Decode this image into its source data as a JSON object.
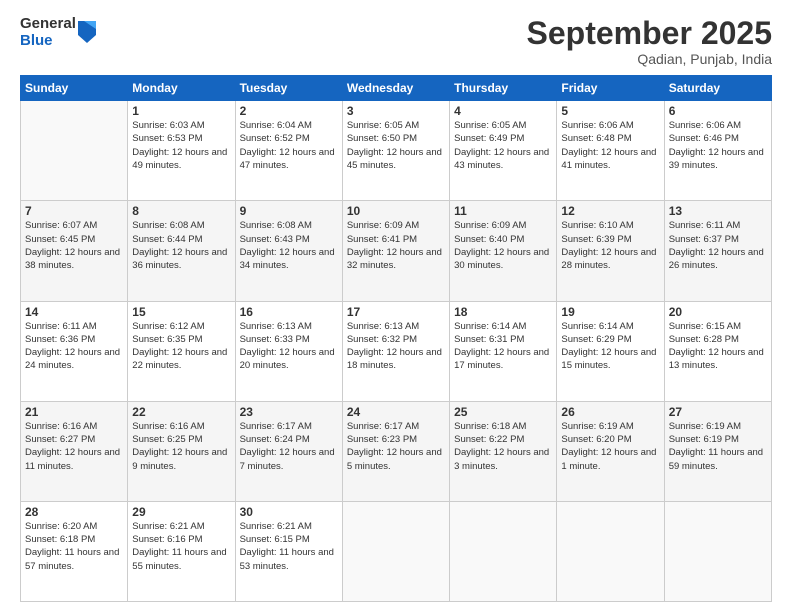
{
  "logo": {
    "general": "General",
    "blue": "Blue"
  },
  "title": "September 2025",
  "subtitle": "Qadian, Punjab, India",
  "weekdays": [
    "Sunday",
    "Monday",
    "Tuesday",
    "Wednesday",
    "Thursday",
    "Friday",
    "Saturday"
  ],
  "weeks": [
    [
      {
        "day": "",
        "sunrise": "",
        "sunset": "",
        "daylight": "",
        "empty": true
      },
      {
        "day": "1",
        "sunrise": "Sunrise: 6:03 AM",
        "sunset": "Sunset: 6:53 PM",
        "daylight": "Daylight: 12 hours and 49 minutes."
      },
      {
        "day": "2",
        "sunrise": "Sunrise: 6:04 AM",
        "sunset": "Sunset: 6:52 PM",
        "daylight": "Daylight: 12 hours and 47 minutes."
      },
      {
        "day": "3",
        "sunrise": "Sunrise: 6:05 AM",
        "sunset": "Sunset: 6:50 PM",
        "daylight": "Daylight: 12 hours and 45 minutes."
      },
      {
        "day": "4",
        "sunrise": "Sunrise: 6:05 AM",
        "sunset": "Sunset: 6:49 PM",
        "daylight": "Daylight: 12 hours and 43 minutes."
      },
      {
        "day": "5",
        "sunrise": "Sunrise: 6:06 AM",
        "sunset": "Sunset: 6:48 PM",
        "daylight": "Daylight: 12 hours and 41 minutes."
      },
      {
        "day": "6",
        "sunrise": "Sunrise: 6:06 AM",
        "sunset": "Sunset: 6:46 PM",
        "daylight": "Daylight: 12 hours and 39 minutes."
      }
    ],
    [
      {
        "day": "7",
        "sunrise": "Sunrise: 6:07 AM",
        "sunset": "Sunset: 6:45 PM",
        "daylight": "Daylight: 12 hours and 38 minutes."
      },
      {
        "day": "8",
        "sunrise": "Sunrise: 6:08 AM",
        "sunset": "Sunset: 6:44 PM",
        "daylight": "Daylight: 12 hours and 36 minutes."
      },
      {
        "day": "9",
        "sunrise": "Sunrise: 6:08 AM",
        "sunset": "Sunset: 6:43 PM",
        "daylight": "Daylight: 12 hours and 34 minutes."
      },
      {
        "day": "10",
        "sunrise": "Sunrise: 6:09 AM",
        "sunset": "Sunset: 6:41 PM",
        "daylight": "Daylight: 12 hours and 32 minutes."
      },
      {
        "day": "11",
        "sunrise": "Sunrise: 6:09 AM",
        "sunset": "Sunset: 6:40 PM",
        "daylight": "Daylight: 12 hours and 30 minutes."
      },
      {
        "day": "12",
        "sunrise": "Sunrise: 6:10 AM",
        "sunset": "Sunset: 6:39 PM",
        "daylight": "Daylight: 12 hours and 28 minutes."
      },
      {
        "day": "13",
        "sunrise": "Sunrise: 6:11 AM",
        "sunset": "Sunset: 6:37 PM",
        "daylight": "Daylight: 12 hours and 26 minutes."
      }
    ],
    [
      {
        "day": "14",
        "sunrise": "Sunrise: 6:11 AM",
        "sunset": "Sunset: 6:36 PM",
        "daylight": "Daylight: 12 hours and 24 minutes."
      },
      {
        "day": "15",
        "sunrise": "Sunrise: 6:12 AM",
        "sunset": "Sunset: 6:35 PM",
        "daylight": "Daylight: 12 hours and 22 minutes."
      },
      {
        "day": "16",
        "sunrise": "Sunrise: 6:13 AM",
        "sunset": "Sunset: 6:33 PM",
        "daylight": "Daylight: 12 hours and 20 minutes."
      },
      {
        "day": "17",
        "sunrise": "Sunrise: 6:13 AM",
        "sunset": "Sunset: 6:32 PM",
        "daylight": "Daylight: 12 hours and 18 minutes."
      },
      {
        "day": "18",
        "sunrise": "Sunrise: 6:14 AM",
        "sunset": "Sunset: 6:31 PM",
        "daylight": "Daylight: 12 hours and 17 minutes."
      },
      {
        "day": "19",
        "sunrise": "Sunrise: 6:14 AM",
        "sunset": "Sunset: 6:29 PM",
        "daylight": "Daylight: 12 hours and 15 minutes."
      },
      {
        "day": "20",
        "sunrise": "Sunrise: 6:15 AM",
        "sunset": "Sunset: 6:28 PM",
        "daylight": "Daylight: 12 hours and 13 minutes."
      }
    ],
    [
      {
        "day": "21",
        "sunrise": "Sunrise: 6:16 AM",
        "sunset": "Sunset: 6:27 PM",
        "daylight": "Daylight: 12 hours and 11 minutes."
      },
      {
        "day": "22",
        "sunrise": "Sunrise: 6:16 AM",
        "sunset": "Sunset: 6:25 PM",
        "daylight": "Daylight: 12 hours and 9 minutes."
      },
      {
        "day": "23",
        "sunrise": "Sunrise: 6:17 AM",
        "sunset": "Sunset: 6:24 PM",
        "daylight": "Daylight: 12 hours and 7 minutes."
      },
      {
        "day": "24",
        "sunrise": "Sunrise: 6:17 AM",
        "sunset": "Sunset: 6:23 PM",
        "daylight": "Daylight: 12 hours and 5 minutes."
      },
      {
        "day": "25",
        "sunrise": "Sunrise: 6:18 AM",
        "sunset": "Sunset: 6:22 PM",
        "daylight": "Daylight: 12 hours and 3 minutes."
      },
      {
        "day": "26",
        "sunrise": "Sunrise: 6:19 AM",
        "sunset": "Sunset: 6:20 PM",
        "daylight": "Daylight: 12 hours and 1 minute."
      },
      {
        "day": "27",
        "sunrise": "Sunrise: 6:19 AM",
        "sunset": "Sunset: 6:19 PM",
        "daylight": "Daylight: 11 hours and 59 minutes."
      }
    ],
    [
      {
        "day": "28",
        "sunrise": "Sunrise: 6:20 AM",
        "sunset": "Sunset: 6:18 PM",
        "daylight": "Daylight: 11 hours and 57 minutes."
      },
      {
        "day": "29",
        "sunrise": "Sunrise: 6:21 AM",
        "sunset": "Sunset: 6:16 PM",
        "daylight": "Daylight: 11 hours and 55 minutes."
      },
      {
        "day": "30",
        "sunrise": "Sunrise: 6:21 AM",
        "sunset": "Sunset: 6:15 PM",
        "daylight": "Daylight: 11 hours and 53 minutes."
      },
      {
        "day": "",
        "sunrise": "",
        "sunset": "",
        "daylight": "",
        "empty": true
      },
      {
        "day": "",
        "sunrise": "",
        "sunset": "",
        "daylight": "",
        "empty": true
      },
      {
        "day": "",
        "sunrise": "",
        "sunset": "",
        "daylight": "",
        "empty": true
      },
      {
        "day": "",
        "sunrise": "",
        "sunset": "",
        "daylight": "",
        "empty": true
      }
    ]
  ]
}
